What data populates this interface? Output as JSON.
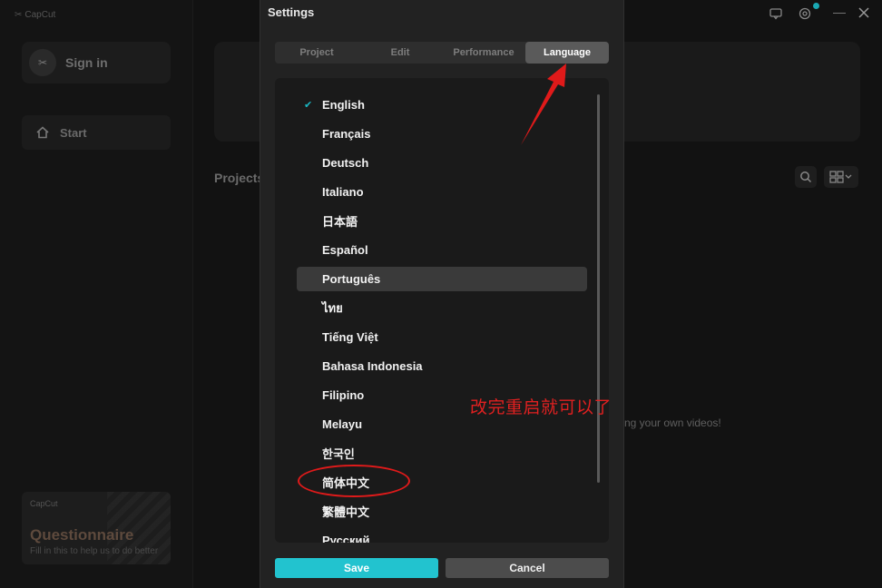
{
  "app": {
    "logo_text": "CapCut",
    "sign_in": "Sign in",
    "start": "Start",
    "projects_heading": "Projects",
    "empty_hint": "ng your own videos!",
    "questionnaire": {
      "logo": "CapCut",
      "title": "Questionnaire",
      "subtitle": "Fill in this to help us to do better"
    }
  },
  "dialog": {
    "title": "Settings",
    "tabs": [
      {
        "label": "Project",
        "active": false
      },
      {
        "label": "Edit",
        "active": false
      },
      {
        "label": "Performance",
        "active": false
      },
      {
        "label": "Language",
        "active": true
      }
    ],
    "languages": [
      {
        "label": "English",
        "selected": true
      },
      {
        "label": "Français"
      },
      {
        "label": "Deutsch"
      },
      {
        "label": "Italiano"
      },
      {
        "label": "日本語"
      },
      {
        "label": "Español"
      },
      {
        "label": "Português",
        "hovered": true
      },
      {
        "label": "ไทย"
      },
      {
        "label": "Tiếng Việt"
      },
      {
        "label": "Bahasa Indonesia"
      },
      {
        "label": "Filipino"
      },
      {
        "label": "Melayu"
      },
      {
        "label": "한국인"
      },
      {
        "label": "简体中文"
      },
      {
        "label": "繁體中文"
      },
      {
        "label": "Русский"
      }
    ],
    "save_label": "Save",
    "cancel_label": "Cancel"
  },
  "annotation": {
    "note": "改完重启就可以了",
    "color": "#e02020"
  },
  "colors": {
    "accent": "#22c3cf",
    "check": "#1ab8c4"
  },
  "icons": [
    "home-icon",
    "search-icon",
    "grid-view-icon",
    "feedback-icon",
    "settings-icon",
    "minimize-icon",
    "close-icon",
    "check-icon"
  ]
}
